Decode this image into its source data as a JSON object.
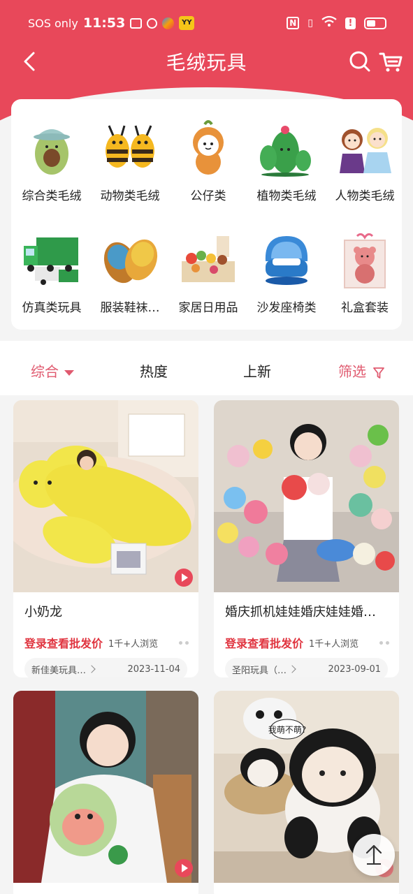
{
  "status_bar": {
    "carrier": "SOS only",
    "time": "11:53",
    "yy_badge": "YY",
    "nfc_label": "N"
  },
  "header": {
    "title": "毛绒玩具"
  },
  "categories": [
    {
      "label": "综合类毛绒",
      "icon": "avocado-plush-icon"
    },
    {
      "label": "动物类毛绒",
      "icon": "bee-plush-icon"
    },
    {
      "label": "公仔类",
      "icon": "tiger-doll-icon"
    },
    {
      "label": "植物类毛绒",
      "icon": "cactus-plush-icon"
    },
    {
      "label": "人物类毛绒",
      "icon": "princess-doll-icon"
    },
    {
      "label": "仿真类玩具",
      "icon": "garbage-truck-icon"
    },
    {
      "label": "服装鞋袜…",
      "icon": "slipper-icon"
    },
    {
      "label": "家居日用品",
      "icon": "toy-food-tray-icon"
    },
    {
      "label": "沙发座椅类",
      "icon": "shell-sofa-icon"
    },
    {
      "label": "礼盒套装",
      "icon": "gift-box-bear-icon"
    }
  ],
  "sort_tabs": [
    {
      "label": "综合",
      "active": true
    },
    {
      "label": "热度",
      "active": false
    },
    {
      "label": "上新",
      "active": false
    },
    {
      "label": "筛选",
      "active": false
    }
  ],
  "products": [
    {
      "title": "小奶龙",
      "price_text": "登录查看批发价",
      "views": "1千+人浏览",
      "shop": "新佳美玩具…",
      "date": "2023-11-04"
    },
    {
      "title": "婚庆抓机娃娃婚庆娃娃婚…",
      "price_text": "登录查看批发价",
      "views": "1千+人浏览",
      "shop": "圣阳玩具（…",
      "date": "2023-09-01"
    },
    {
      "title": ""
    },
    {
      "title": "",
      "badge_text": "我萌不萌?"
    }
  ],
  "colors": {
    "brand": "#e8485a",
    "active_tab": "#e05a6f",
    "price": "#e0343f"
  }
}
